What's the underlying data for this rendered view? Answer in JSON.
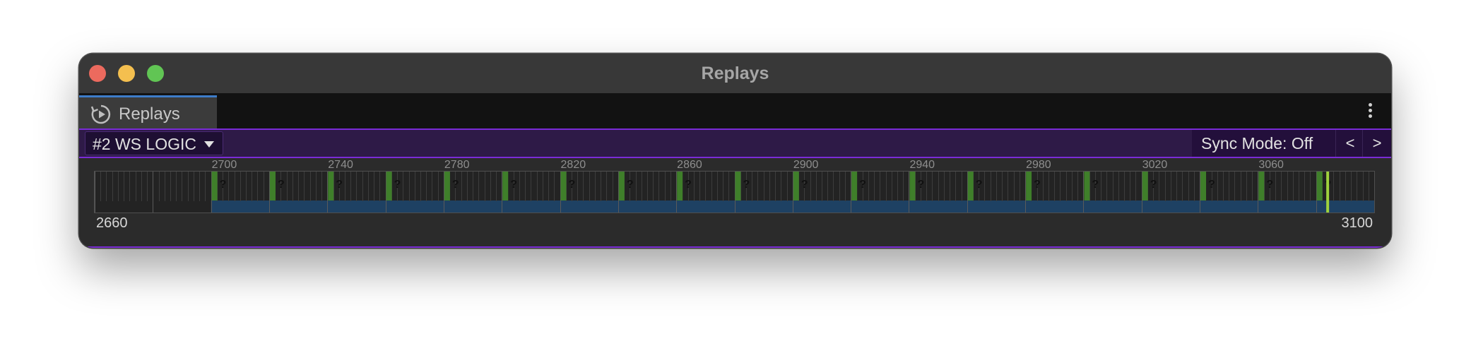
{
  "window": {
    "title": "Replays"
  },
  "tab": {
    "label": "Replays",
    "icon": "replay-icon"
  },
  "toolbar": {
    "dropdown_value": "#2 WS LOGIC",
    "sync_mode": "Sync Mode: Off",
    "prev_label": "<",
    "next_label": ">"
  },
  "timeline": {
    "range_min": "2660",
    "range_max": "3100",
    "tick_labels": [
      "2700",
      "2740",
      "2780",
      "2820",
      "2860",
      "2900",
      "2940",
      "2980",
      "3020",
      "3060"
    ],
    "frame_marker_label": "?",
    "frame_markers": [
      2700,
      2720,
      2740,
      2760,
      2780,
      2800,
      2820,
      2840,
      2860,
      2880,
      2900,
      2920,
      2940,
      2960,
      2980,
      3000,
      3020,
      3040,
      3060,
      3080
    ],
    "recorded_start": 2700,
    "recorded_end": 3100,
    "playhead": 3084,
    "colors": {
      "marker": "#3f7f2a",
      "recorded": "#1e4163",
      "playhead": "#9fd23d",
      "accent": "#7a2bd6"
    }
  }
}
